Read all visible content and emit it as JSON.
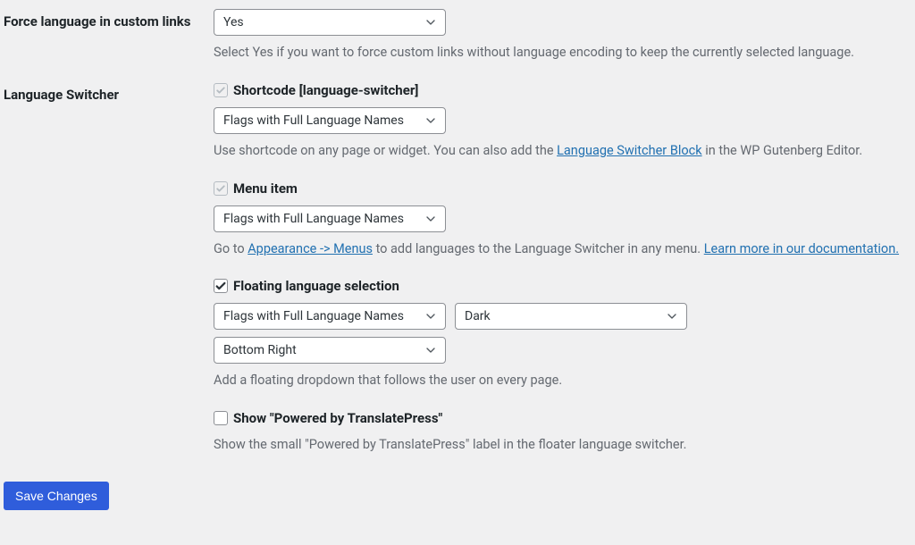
{
  "row1": {
    "label": "Force language in custom links",
    "select_value": "Yes",
    "description": "Select Yes if you want to force custom links without language encoding to keep the currently selected language."
  },
  "row2": {
    "label": "Language Switcher",
    "shortcode": {
      "label": "Shortcode [language-switcher]",
      "select_value": "Flags with Full Language Names",
      "desc_prefix": "Use shortcode on any page or widget. You can also add the ",
      "link_text": "Language Switcher Block",
      "desc_suffix": " in the WP Gutenberg Editor."
    },
    "menuitem": {
      "label": "Menu item",
      "select_value": "Flags with Full Language Names",
      "desc_prefix": "Go to ",
      "link1_text": "Appearance -> Menus",
      "desc_mid": " to add languages to the Language Switcher in any menu. ",
      "link2_text": "Learn more in our documentation."
    },
    "floating": {
      "label": "Floating language selection",
      "select1": "Flags with Full Language Names",
      "select2": "Dark",
      "select3": "Bottom Right",
      "desc": "Add a floating dropdown that follows the user on every page."
    },
    "powered": {
      "label": "Show \"Powered by TranslatePress\"",
      "desc": "Show the small \"Powered by TranslatePress\" label in the floater language switcher."
    }
  },
  "save_label": "Save Changes"
}
